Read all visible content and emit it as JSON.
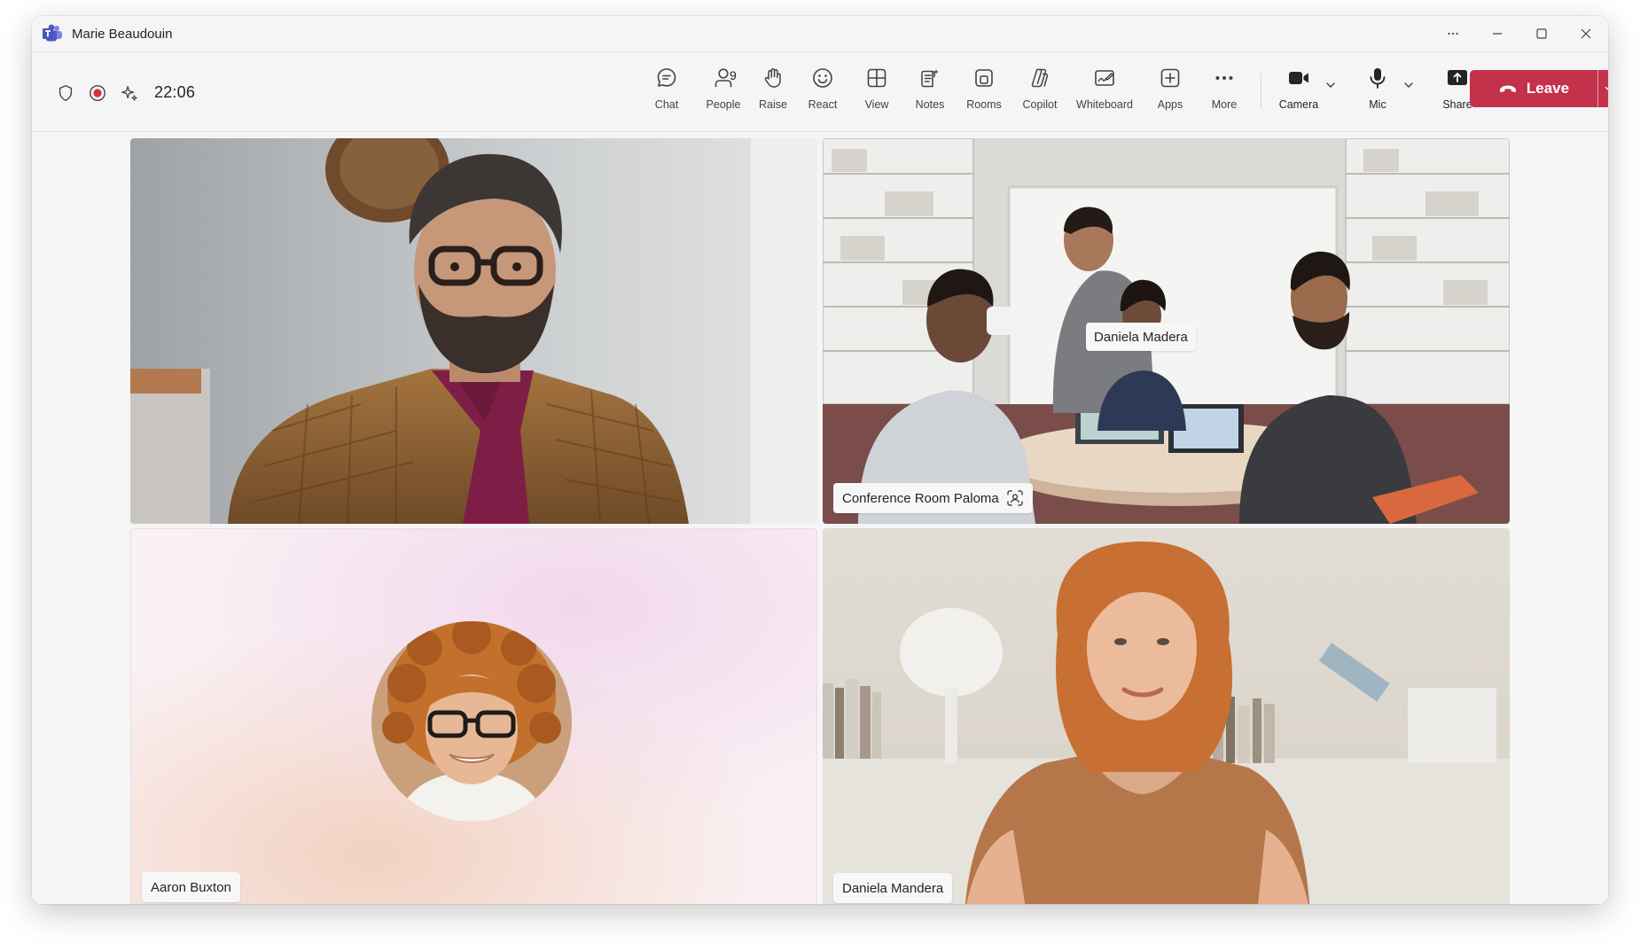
{
  "window": {
    "title": "Marie Beaudouin",
    "controls": {
      "more": "more-horizontal-icon",
      "minimize": "minimize-icon",
      "maximize": "maximize-icon",
      "close": "close-icon"
    }
  },
  "status": {
    "timer": "22:06",
    "icons": [
      "shield-icon",
      "recording-icon",
      "sparkle-icon"
    ]
  },
  "toolbar": {
    "chat_label": "Chat",
    "people_label": "People",
    "people_count": "9",
    "raise_label": "Raise",
    "react_label": "React",
    "view_label": "View",
    "notes_label": "Notes",
    "rooms_label": "Rooms",
    "copilot_label": "Copilot",
    "whiteboard_label": "Whiteboard",
    "apps_label": "Apps",
    "more_label": "More",
    "camera_label": "Camera",
    "mic_label": "Mic",
    "share_label": "Share",
    "leave_label": "Leave"
  },
  "participants": [
    {
      "name": "",
      "tile": "video"
    },
    {
      "name": "Conference Room Paloma",
      "speaker_label": "Daniela Madera",
      "tile": "room"
    },
    {
      "name": "Aaron Buxton",
      "tile": "avatar"
    },
    {
      "name": "Daniela Mandera",
      "tile": "video"
    }
  ],
  "colors": {
    "leave": "#c4314b",
    "brand": "#5b5fc7",
    "recording": "#d13438"
  }
}
